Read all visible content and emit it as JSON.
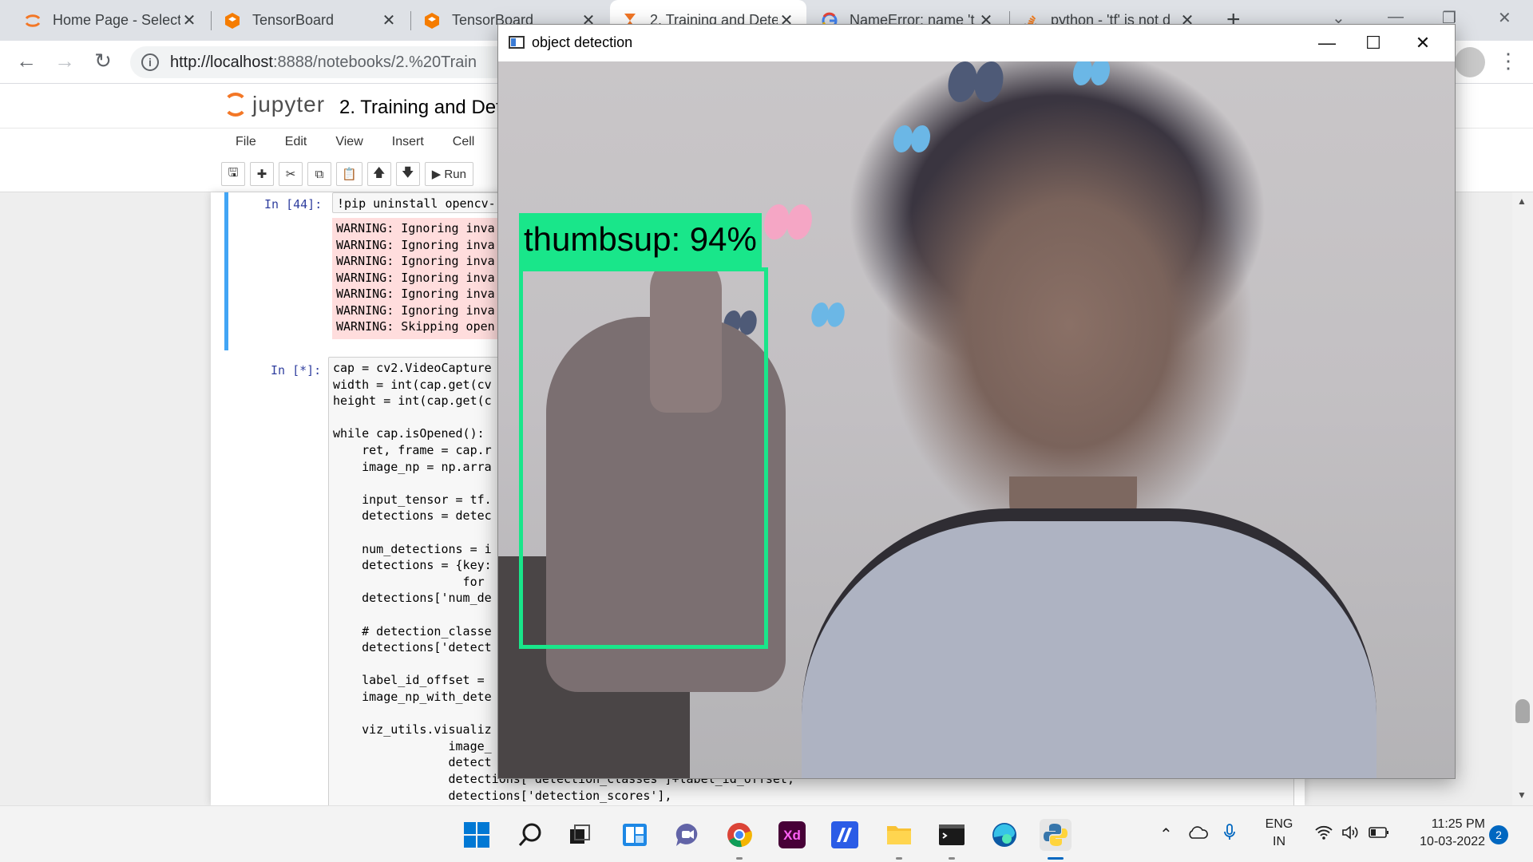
{
  "browser": {
    "tabs": [
      {
        "label": "Home Page - Select",
        "icon": "jupyter-icon"
      },
      {
        "label": "TensorBoard",
        "icon": "tensorboard-icon"
      },
      {
        "label": "TensorBoard",
        "icon": "tensorboard-icon"
      },
      {
        "label": "2. Training and Dete",
        "icon": "jupyter-hourglass-icon",
        "active": true
      },
      {
        "label": "NameError: name 't",
        "icon": "google-icon"
      },
      {
        "label": "python - 'tf' is not d",
        "icon": "stackoverflow-icon"
      }
    ],
    "url_host": "http://localhost",
    "url_rest": ":8888/notebooks/2.%20Train"
  },
  "jupyter": {
    "logo_text": "jupyter",
    "notebook_title": "2. Training and Dete",
    "menu": [
      "File",
      "Edit",
      "View",
      "Insert",
      "Cell"
    ],
    "run_label": "Run"
  },
  "cells": {
    "cell1_prompt": "In [44]:",
    "cell1_code": "!pip uninstall opencv-",
    "cell1_output": [
      "WARNING: Ignoring inva",
      "WARNING: Ignoring inva",
      "WARNING: Ignoring inva",
      "WARNING: Ignoring inva",
      "WARNING: Ignoring inva",
      "WARNING: Ignoring inva",
      "WARNING: Skipping open"
    ],
    "cell2_prompt": "In [*]:",
    "cell2_lines": [
      "cap = cv2.VideoCapture",
      "width = int(cap.get(cv",
      "height = int(cap.get(c",
      "",
      "while cap.isOpened():",
      "    ret, frame = cap.r",
      "    image_np = np.arra",
      "",
      "    input_tensor = tf.",
      "    detections = detec",
      "",
      "    num_detections = i",
      "    detections = {key:",
      "                  for",
      "    detections['num_de",
      "",
      "    # detection_classe",
      "    detections['detect",
      "",
      "    label_id_offset = ",
      "    image_np_with_dete",
      "",
      "    viz_utils.visualiz",
      "                image_",
      "                detect",
      "                detections['detection_classes']+label_id_offset,",
      "                detections['detection_scores'],"
    ]
  },
  "cv_window": {
    "title": "object detection",
    "detection_label": "thumbsup: 94%",
    "box_color": "#19e68a"
  },
  "taskbar": {
    "apps": [
      "windows-start-icon",
      "search-icon",
      "task-view-icon",
      "widgets-icon",
      "teams-chat-icon",
      "chrome-icon",
      "adobe-xd-icon",
      "visual-studio-icon",
      "file-explorer-icon",
      "terminal-icon",
      "edge-icon",
      "python-icon"
    ],
    "lang_top": "ENG",
    "lang_bottom": "IN",
    "time": "11:25 PM",
    "date": "10-03-2022",
    "notification_count": "2"
  }
}
